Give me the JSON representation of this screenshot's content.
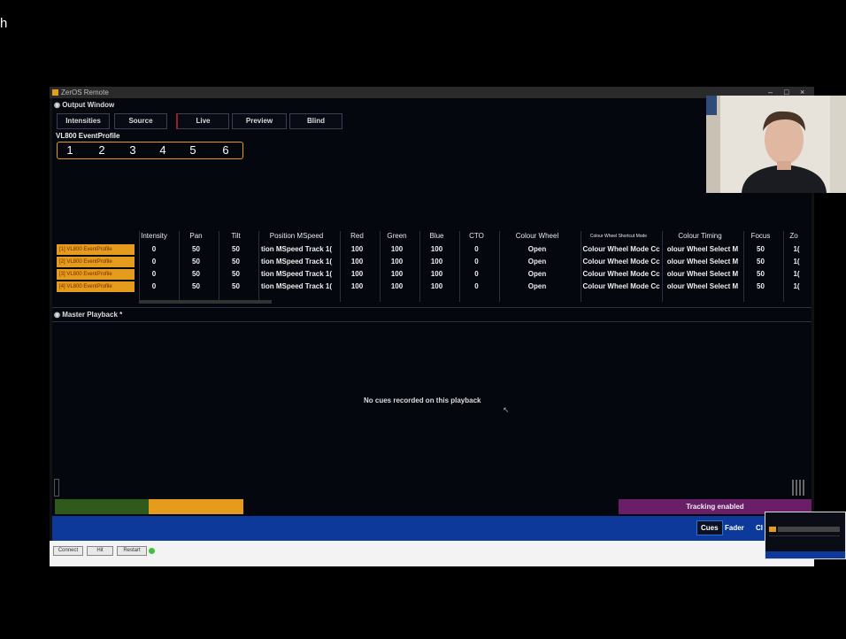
{
  "stray_text": "h",
  "window": {
    "title": "ZerOS Remote",
    "controls": [
      "–",
      "□",
      "×"
    ]
  },
  "output_window": {
    "header": "Output Window",
    "tabs": [
      "Intensities",
      "Source",
      "Live",
      "Preview",
      "Blind"
    ],
    "fixture_title": "VL800 EventProfile",
    "numbers": [
      "1",
      "2",
      "3",
      "4",
      "5",
      "6"
    ],
    "columns": [
      "Intensity",
      "Pan",
      "Tilt",
      "Position MSpeed",
      "Red",
      "Green",
      "Blue",
      "CTO",
      "Colour Wheel",
      "Colour Wheel Shortcut Mode",
      "Colour Timing",
      "Focus",
      "Zo"
    ],
    "rows": [
      {
        "label": "[1] VL800 EventProfile",
        "values": [
          "0",
          "50",
          "50",
          "tion MSpeed Track 1(",
          "100",
          "100",
          "100",
          "0",
          "Open",
          "Colour Wheel Mode Cc",
          "olour Wheel Select M",
          "50",
          "1("
        ]
      },
      {
        "label": "[2] VL800 EventProfile",
        "values": [
          "0",
          "50",
          "50",
          "tion MSpeed Track 1(",
          "100",
          "100",
          "100",
          "0",
          "Open",
          "Colour Wheel Mode Cc",
          "olour Wheel Select M",
          "50",
          "1("
        ]
      },
      {
        "label": "[3] VL800 EventProfile",
        "values": [
          "0",
          "50",
          "50",
          "tion MSpeed Track 1(",
          "100",
          "100",
          "100",
          "0",
          "Open",
          "Colour Wheel Mode Cc",
          "olour Wheel Select M",
          "50",
          "1("
        ]
      },
      {
        "label": "[4] VL800 EventProfile",
        "values": [
          "0",
          "50",
          "50",
          "tion MSpeed Track 1(",
          "100",
          "100",
          "100",
          "0",
          "Open",
          "Colour Wheel Mode Cc",
          "olour Wheel Select M",
          "50",
          "1("
        ]
      }
    ]
  },
  "master_playback": {
    "header": "Master Playback *",
    "empty_message": "No cues recorded on this playback",
    "status": "Tracking enabled"
  },
  "bottom_modes": [
    "Cues",
    "Fader",
    "Cl"
  ],
  "footer_buttons": [
    "Connect",
    "Hit",
    "Restart"
  ],
  "colors": {
    "accent": "#e59c1c",
    "green_bar": "#2e5a1c",
    "tracking": "#6a1e68",
    "blue_bar": "#0d3a9a"
  }
}
